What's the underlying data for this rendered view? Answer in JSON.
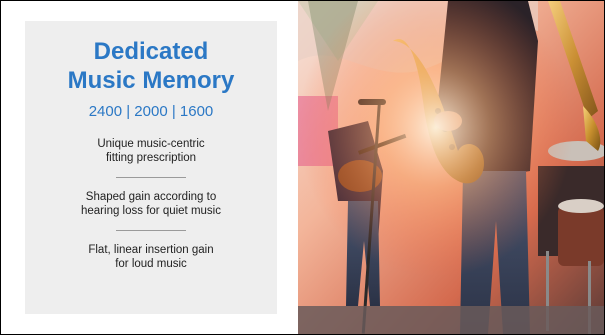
{
  "panel": {
    "title_line1": "Dedicated",
    "title_line2": "Music Memory",
    "models": "2400 | 2000 | 1600",
    "features": [
      {
        "line1": "Unique music-centric",
        "line2": "fitting prescription"
      },
      {
        "line1": "Shaped gain according to",
        "line2": "hearing loss for quiet music"
      },
      {
        "line1": "Flat, linear insertion gain",
        "line2": "for loud music"
      }
    ]
  },
  "photo": {
    "subject": "band-performance-photo"
  },
  "colors": {
    "accent": "#2b78c5",
    "panel_bg": "#eeeeee",
    "frame": "#000000"
  }
}
